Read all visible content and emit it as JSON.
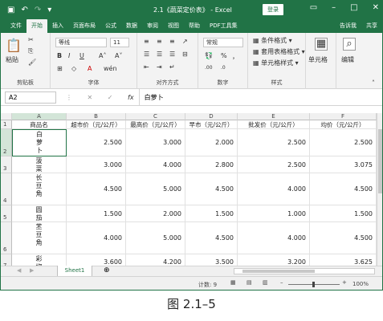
{
  "titlebar": {
    "title": "2.1《蔬菜定价表》 - Excel",
    "login": "登录",
    "save_icon": "save-icon",
    "undo_icon": "undo-icon",
    "redo_icon": "redo-icon",
    "bg": "#217346"
  },
  "tabs": [
    {
      "label": "文件"
    },
    {
      "label": "开始",
      "active": true
    },
    {
      "label": "插入"
    },
    {
      "label": "页面布局"
    },
    {
      "label": "公式"
    },
    {
      "label": "数据"
    },
    {
      "label": "审阅"
    },
    {
      "label": "视图"
    },
    {
      "label": "帮助"
    },
    {
      "label": "PDF工具集"
    },
    {
      "label": "告诉我"
    },
    {
      "label": "共享"
    }
  ],
  "ribbon": {
    "clipboard": {
      "label": "剪贴板",
      "paste": "粘贴"
    },
    "font": {
      "label": "字体",
      "name": "等线",
      "size": "11",
      "bold": "B",
      "italic": "I",
      "underline": "U"
    },
    "align": {
      "label": "对齐方式"
    },
    "number": {
      "label": "数字",
      "format": "常规",
      "percent": "%",
      "comma": "，"
    },
    "styles": {
      "label": "样式",
      "cond": "条件格式",
      "table": "套用表格格式",
      "cell": "单元格样式"
    },
    "cells": {
      "label": "单元格"
    },
    "edit": {
      "label": "编辑"
    }
  },
  "formula": {
    "namebox": "A2",
    "value": "白萝卜"
  },
  "columns": [
    "A",
    "B",
    "C",
    "D",
    "E",
    "F"
  ],
  "header_row": [
    "商品名",
    "超市价（元/公斤）",
    "最高价（元/公斤）",
    "早市（元/公斤）",
    "批发价（元/公斤）",
    "均价（元/公斤）"
  ],
  "rows": [
    {
      "num": "2",
      "name": "白萝卜",
      "vals": [
        "2.500",
        "3.000",
        "2.000",
        "2.500",
        "2.500"
      ]
    },
    {
      "num": "3",
      "name": "菠菜",
      "vals": [
        "3.000",
        "4.000",
        "2.800",
        "2.500",
        "3.075"
      ]
    },
    {
      "num": "4",
      "name": "长豆角",
      "vals": [
        "4.500",
        "5.000",
        "4.500",
        "4.000",
        "4.500"
      ]
    },
    {
      "num": "5",
      "name": "圆茄",
      "vals": [
        "1.500",
        "2.000",
        "1.500",
        "1.000",
        "1.500"
      ]
    },
    {
      "num": "6",
      "name": "苤豆角",
      "vals": [
        "4.000",
        "5.000",
        "4.500",
        "4.000",
        "4.500"
      ]
    },
    {
      "num": "7",
      "name": "彩椒",
      "vals": [
        "3.600",
        "4.200",
        "3.500",
        "3.200",
        "3.625"
      ]
    }
  ],
  "sheet": {
    "tab": "Sheet1",
    "add": "⊕"
  },
  "status": {
    "count": "计数: 9",
    "zoom": "100%"
  },
  "caption": "图 2.1–5"
}
